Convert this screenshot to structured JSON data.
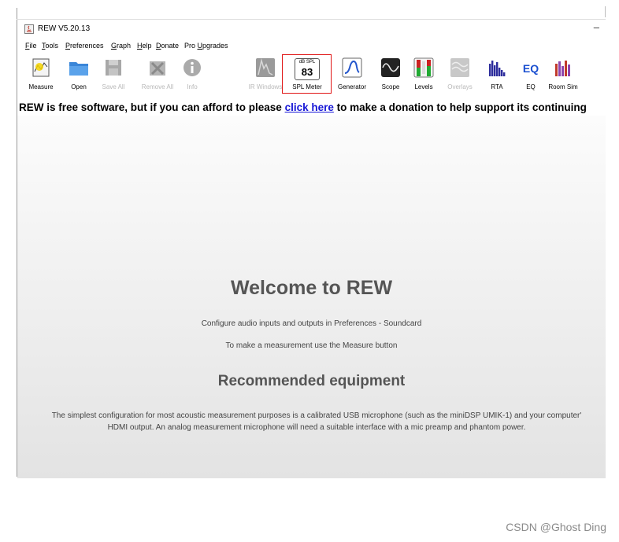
{
  "window": {
    "title": "REW V5.20.13",
    "minimize": "–"
  },
  "menu": [
    {
      "label": "File",
      "key": "F",
      "rest": "ile"
    },
    {
      "label": "Tools",
      "key": "T",
      "rest": "ools"
    },
    {
      "label": "Preferences",
      "key": "P",
      "rest": "references"
    },
    {
      "label": "Graph",
      "key": "G",
      "rest": "raph"
    },
    {
      "label": "Help",
      "key": "H",
      "rest": "elp"
    },
    {
      "label": "Donate",
      "key": "D",
      "rest": "onate"
    },
    {
      "label": "Pro Upgrades",
      "pre": "Pro ",
      "key": "U",
      "rest": "pgrades"
    }
  ],
  "toolbar": {
    "measure": "Measure",
    "open": "Open",
    "save_all": "Save All",
    "remove_all": "Remove All",
    "info": "Info",
    "ir_windows": "IR Windows",
    "spl_meter": "SPL Meter",
    "spl_unit": "dB SPL",
    "spl_value": "83",
    "generator": "Generator",
    "scope": "Scope",
    "levels": "Levels",
    "overlays": "Overlays",
    "rta": "RTA",
    "eq": "EQ",
    "eq_icon_text": "EQ",
    "room_sim": "Room Sim"
  },
  "donation": {
    "before": "REW is free software, but if you can afford to please ",
    "link": "click here",
    "after": " to make a donation to help support its continuing"
  },
  "content": {
    "welcome": "Welcome to REW",
    "line1": "Configure audio inputs and outputs in Preferences - Soundcard",
    "line2": "To make a measurement use the Measure button",
    "recommended": "Recommended equipment",
    "eq_line1": "The simplest configuration for most acoustic measurement purposes is a calibrated USB microphone (such as the miniDSP UMIK-1) and your computer'",
    "eq_line2": "HDMI output. An analog measurement microphone will need a suitable interface with a mic preamp and phantom power."
  },
  "watermark": "CSDN @Ghost Ding",
  "colors": {
    "link": "#1515d6",
    "highlight": "#e01515",
    "eq_blue": "#1a4fd0"
  }
}
